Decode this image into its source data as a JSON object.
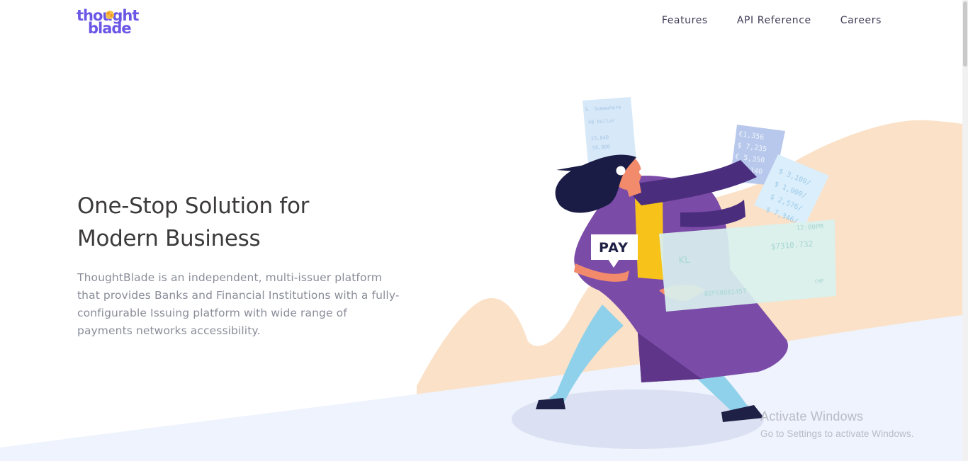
{
  "header": {
    "logo_line1": "thought",
    "logo_line2": "blade",
    "nav": [
      "Features",
      "API Reference",
      "Careers"
    ]
  },
  "hero": {
    "title_line1": "One-Stop Solution for",
    "title_line2": "Modern Business",
    "description_lines": [
      "ThoughtBlade is an independent, multi-issuer platform",
      "that provides Banks and Financial Institutions with a fully-",
      "configurable Issuing platform with wide range of",
      "payments networks accessibility."
    ]
  },
  "illustration": {
    "pay_label": "PAY",
    "receipt_amounts": [
      "€1,356",
      "$ 7,235",
      "€ 5,350",
      "$ 3,140",
      "$ 3,100/",
      "$ 1,000/",
      "$ 2,576/",
      "$ 7,346/"
    ],
    "receipt_small": [
      "S. Somewhere",
      "48 Dollar",
      "23,840",
      "56,000"
    ],
    "check_time": "12:00PM",
    "check_amount": "$7310.732",
    "check_number": "02F6008I457",
    "check_code": "CMP",
    "check_letters": "KL"
  },
  "watermark": {
    "title": "Activate Windows",
    "subtitle": "Go to Settings to activate Windows."
  },
  "colors": {
    "brand": "#6b57e6",
    "peach": "#fbe1c7",
    "ground": "#eef3fd",
    "coat": "#7b4ba8",
    "pants": "#8fd1ea",
    "shirt": "#f7c21a",
    "check": "#d9f1ef"
  }
}
